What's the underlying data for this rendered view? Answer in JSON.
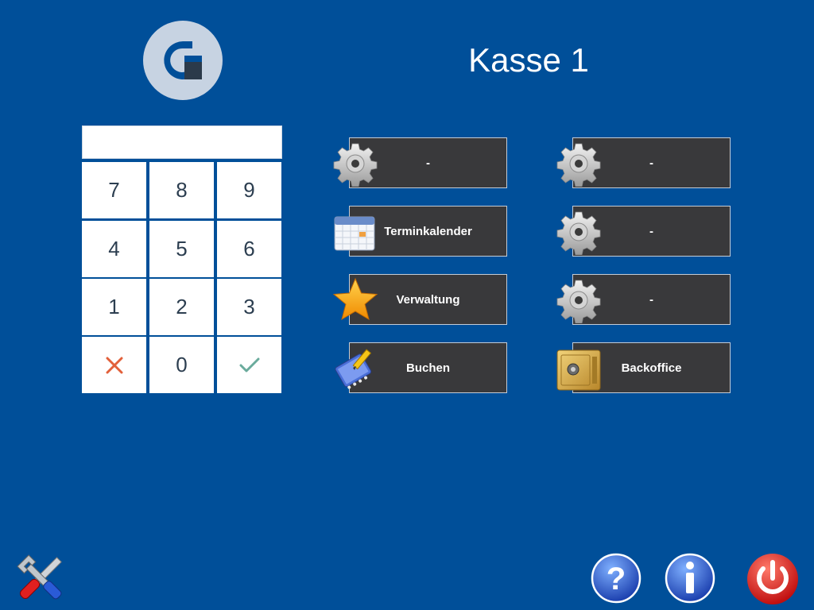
{
  "header": {
    "title": "Kasse 1",
    "logo_icon": "brand-logo-icon"
  },
  "keypad": {
    "display_value": "",
    "keys": [
      "7",
      "8",
      "9",
      "4",
      "5",
      "6",
      "1",
      "2",
      "3"
    ],
    "zero": "0",
    "cancel_icon": "cross-icon",
    "confirm_icon": "checkmark-icon"
  },
  "tiles_left": [
    {
      "label": "-",
      "icon": "gear-icon"
    },
    {
      "label": "Terminkalender",
      "icon": "calendar-icon"
    },
    {
      "label": "Verwaltung",
      "icon": "star-icon"
    },
    {
      "label": "Buchen",
      "icon": "notebook-pencil-icon"
    }
  ],
  "tiles_right": [
    {
      "label": "-",
      "icon": "gear-icon"
    },
    {
      "label": "-",
      "icon": "gear-icon"
    },
    {
      "label": "-",
      "icon": "gear-icon"
    },
    {
      "label": "Backoffice",
      "icon": "safe-icon"
    }
  ],
  "footer": {
    "tools_icon": "tools-icon",
    "help_icon": "help-icon",
    "info_icon": "info-icon",
    "power_icon": "power-icon"
  },
  "colors": {
    "background": "#004f99",
    "tile": "#39393b",
    "cancel": "#e2603a",
    "confirm": "#6aab9c",
    "power": "#d42020"
  }
}
